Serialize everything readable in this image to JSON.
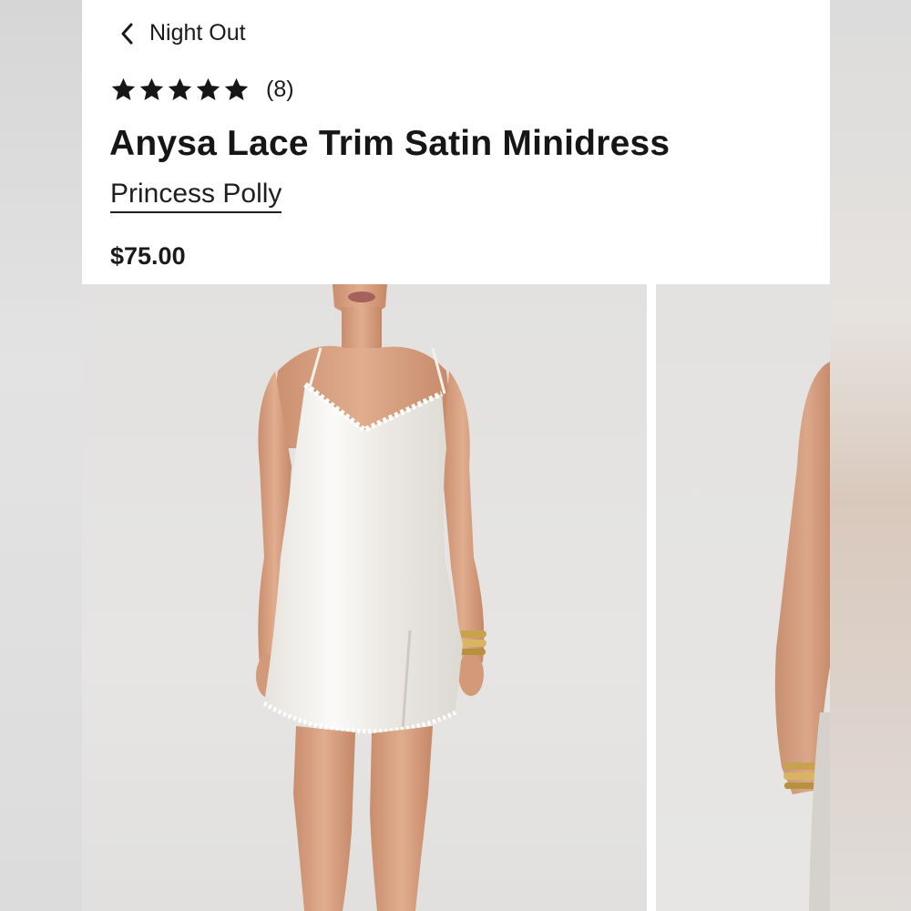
{
  "nav": {
    "back_label": "Night Out",
    "back_icon": "chevron-left-icon"
  },
  "product": {
    "rating": {
      "stars": 5,
      "out_of": 5,
      "count": "(8)"
    },
    "title": "Anysa Lace Trim Satin Minidress",
    "brand": "Princess Polly",
    "price": "$75.00"
  },
  "gallery": {
    "images": [
      {
        "depicts": "model-front-view"
      },
      {
        "depicts": "model-side-view"
      }
    ]
  },
  "colors": {
    "text": "#1a1a1a",
    "background": "#ffffff",
    "image_bg": "#e4e3e1",
    "skin": "#d9a384",
    "dress": "#f1efeb",
    "gold": "#c9a24e"
  }
}
